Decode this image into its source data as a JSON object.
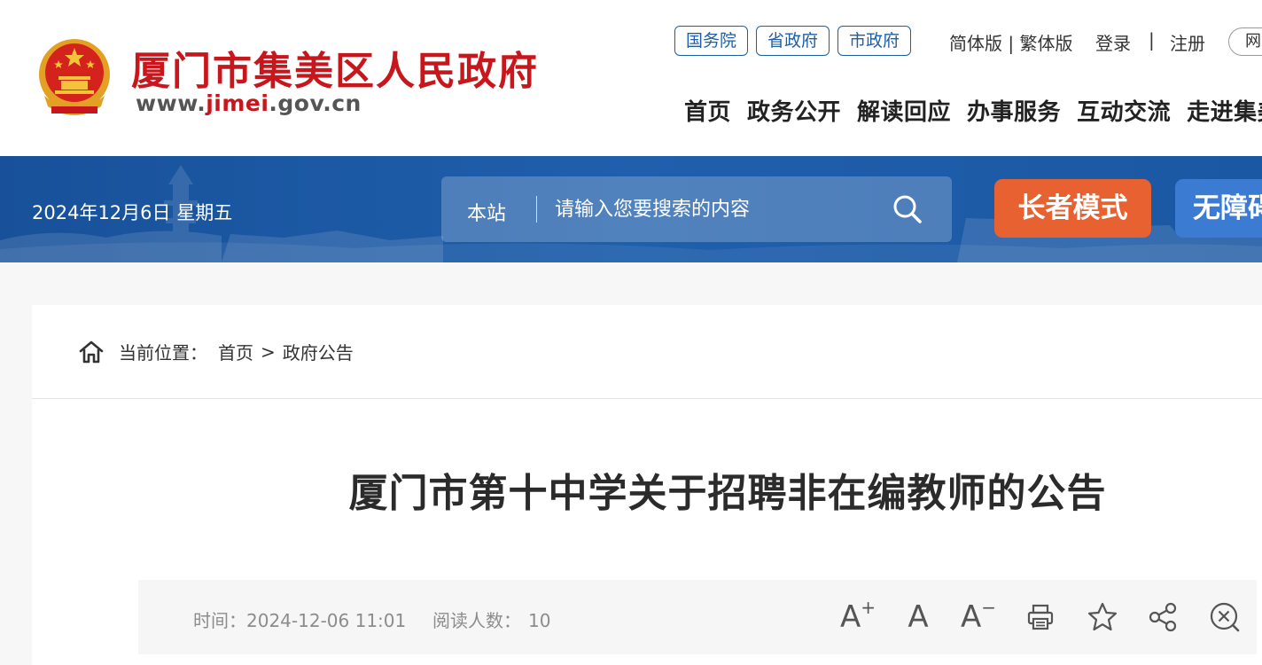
{
  "header": {
    "site_name": "厦门市集美区人民政府",
    "url_prefix": "www.",
    "url_highlight": "jimei",
    "url_suffix": ".gov.cn",
    "gov_links": [
      "国务院",
      "省政府",
      "市政府"
    ],
    "lang_links": "简体版 | 繁体版",
    "login": "登录",
    "separator": "|",
    "register": "注册",
    "net_button": "网",
    "nav": [
      "首页",
      "政务公开",
      "解读回应",
      "办事服务",
      "互动交流",
      "走进集美"
    ]
  },
  "banner": {
    "date": "2024年12月6日 星期五",
    "search_scope": "本站",
    "search_placeholder": "请输入您要搜索的内容",
    "elder_mode": "长者模式",
    "accessibility": "无障碍"
  },
  "breadcrumb": {
    "label": "当前位置：",
    "home": "首页",
    "sep": ">",
    "current": "政府公告"
  },
  "article": {
    "title": "厦门市第十中学关于招聘非在编教师的公告",
    "time_label": "时间：",
    "time": "2024-12-06 11:01",
    "read_label": "阅读人数：",
    "read_count": "10",
    "tools": {
      "font_increase": "A",
      "font_normal": "A",
      "font_decrease": "A"
    }
  },
  "colors": {
    "brand_red": "#c8161d",
    "banner_blue": "#1f5fac",
    "elder_orange": "#e86131",
    "access_blue": "#3b7bd1"
  }
}
